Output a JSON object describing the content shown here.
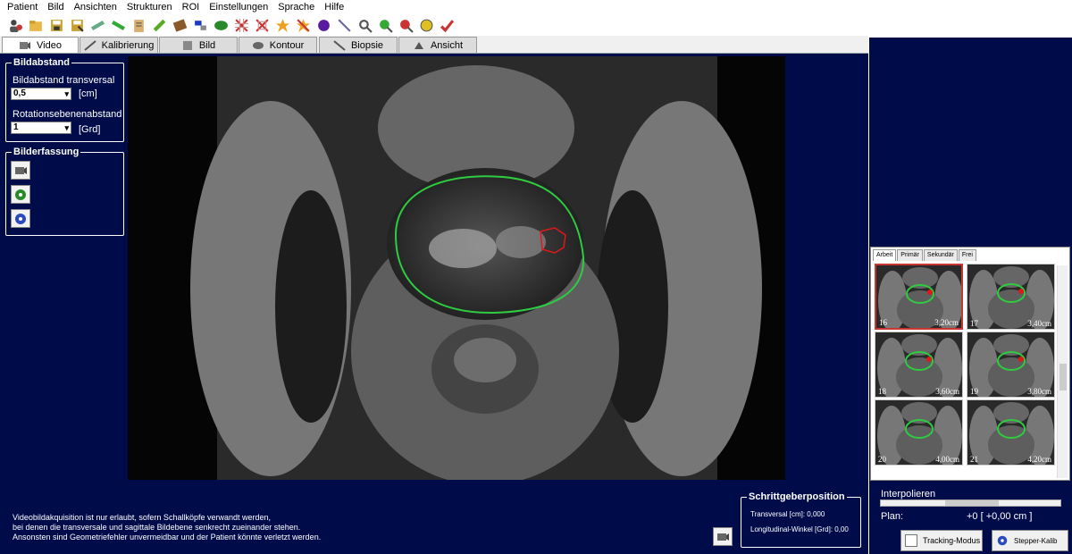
{
  "menu": [
    "Patient",
    "Bild",
    "Ansichten",
    "Strukturen",
    "ROI",
    "Einstellungen",
    "Sprache",
    "Hilfe"
  ],
  "tabs": [
    {
      "label": "Video",
      "active": true
    },
    {
      "label": "Kalibrierung",
      "active": false
    },
    {
      "label": "Bild",
      "active": false
    },
    {
      "label": "Kontour",
      "active": false
    },
    {
      "label": "Biopsie",
      "active": false
    },
    {
      "label": "Ansicht",
      "active": false
    }
  ],
  "bildabstand": {
    "title": "Bildabstand",
    "transversal_label": "Bildabstand transversal",
    "transversal_value": "0,5",
    "transversal_unit": "[cm]",
    "rotation_label": "Rotationsebenenabstand",
    "rotation_value": "1",
    "rotation_unit": "[Grd]"
  },
  "bilderfassung": {
    "title": "Bilderfassung"
  },
  "warning": [
    "Videobildakquisition ist nur erlaubt, sofern Schallköpfe verwandt werden,",
    "bei denen die transversale und sagittale Bildebene senkrecht zueinander stehen.",
    "Ansonsten sind Geometriefehler unvermeidbar und der Patient könnte verletzt werden."
  ],
  "schrittgeber": {
    "title": "Schrittgeberposition",
    "transversal": "Transversal [cm]: 0,000",
    "longitudinal": "Longitudinal-Winkel [Grd]: 0,00"
  },
  "thumb_tabs": [
    "Arbeit",
    "Primär",
    "Sekundär",
    "Frei"
  ],
  "thumbnails": [
    {
      "n": "16",
      "pos": "3,20cm",
      "roi": true
    },
    {
      "n": "17",
      "pos": "3,40cm",
      "roi": true
    },
    {
      "n": "18",
      "pos": "3,60cm",
      "roi": true
    },
    {
      "n": "19",
      "pos": "3,80cm",
      "roi": true
    },
    {
      "n": "20",
      "pos": "4,00cm",
      "roi": false
    },
    {
      "n": "21",
      "pos": "4,20cm",
      "roi": false
    }
  ],
  "interpolieren": {
    "label": "Interpolieren",
    "plan_label": "Plan:",
    "plan_value": "+0 [ +0,00 cm ]"
  },
  "buttons": {
    "tracking": "Tracking-Modus",
    "stepper": "Stepper-Kalib"
  },
  "colors": {
    "background": "#000c4a",
    "contour": "#2ecc40",
    "roi": "#e01818"
  }
}
